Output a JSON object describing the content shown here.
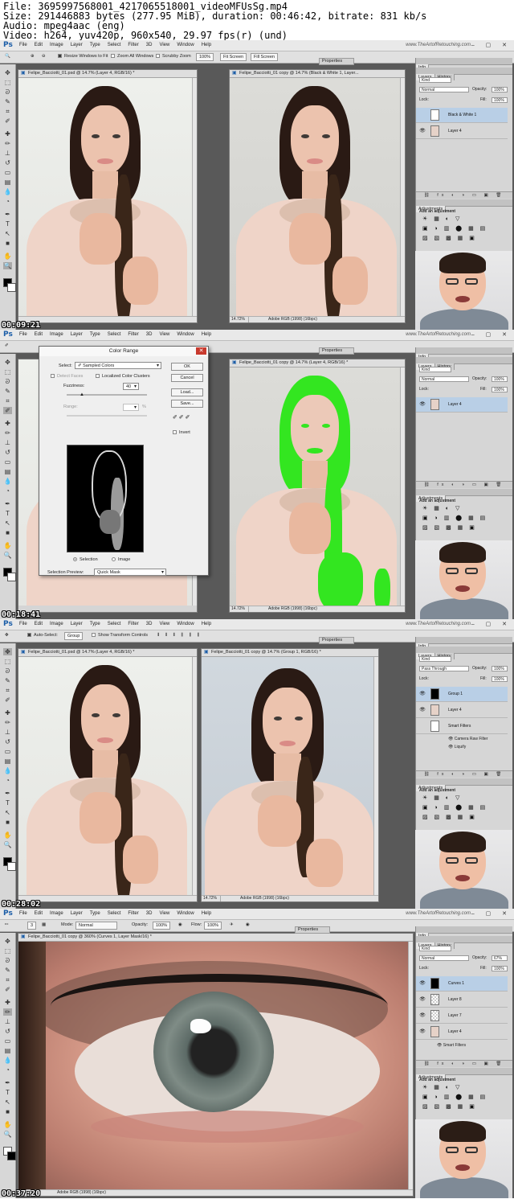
{
  "file_info": {
    "line1": "File: 3695997568001_4217065518001_videoMFUsSg.mp4",
    "line2": "Size: 291446883 bytes (277.95 MiB), duration: 00:46:42, bitrate: 831 kb/s",
    "line3": "Audio: mpeg4aac (eng)",
    "line4": "Video: h264, yuv420p, 960x540, 29.97 fps(r) (und)"
  },
  "app": {
    "logo": "Ps",
    "menus": [
      "File",
      "Edit",
      "Image",
      "Layer",
      "Type",
      "Select",
      "Filter",
      "3D",
      "View",
      "Window",
      "Help"
    ],
    "site": "www.TheArtofRetouching.com",
    "window_controls": "– ▢ ✕"
  },
  "panels": [
    {
      "timecode": "00:09:21",
      "options": {
        "resize": "Resize Windows to Fit",
        "zoom_all": "Zoom All Windows",
        "scrubby": "Scrubby Zoom",
        "zoom_value": "100%",
        "fit_screen": "Fit Screen",
        "fill_screen": "Fill Screen"
      },
      "doc1": {
        "title": "Felipe_Bacciotti_01.psd @ 14.7% (Layer 4, RGB/16) *",
        "zoom": "",
        "profile": ""
      },
      "doc2": {
        "title": "Felipe_Bacciotti_01 copy @ 14.7% (Black & White 1, Layer...",
        "zoom": "14.72%",
        "profile": "Adobe RGB (1998) (16bpc)"
      },
      "tabs": {
        "properties": "Properties",
        "info": "Info"
      },
      "layers_panel": {
        "tabs": [
          "Layers",
          "History"
        ],
        "kind": "Kind",
        "blend": "Normal",
        "opacity_label": "Opacity:",
        "opacity": "100%",
        "lock_label": "Lock:",
        "fill_label": "Fill:",
        "fill": "100%",
        "layers": [
          "Black & White 1",
          "Layer 4"
        ],
        "adjustments_tab": "Adjustments",
        "add_adjustment": "Add an adjustment"
      }
    },
    {
      "timecode": "00:18:41",
      "doc2": {
        "title": "Felipe_Bacciotti_01 copy @ 14.7% (Layer 4, RGB/16) *",
        "zoom": "14.72%",
        "profile": "Adobe RGB (1998) (16bpc)"
      },
      "tabs": {
        "properties": "Properties",
        "info": "Info"
      },
      "color_range": {
        "title": "Color Range",
        "select_label": "Select:",
        "select_value": "Sampled Colors",
        "detect_faces": "Detect Faces",
        "localized": "Localized Color Clusters",
        "fuzziness_label": "Fuzziness:",
        "fuzziness": "40",
        "range_label": "Range:",
        "range_unit": "%",
        "ok": "OK",
        "cancel": "Cancel",
        "load": "Load...",
        "save": "Save...",
        "invert": "Invert",
        "selection": "Selection",
        "image": "Image",
        "preview_label": "Selection Preview:",
        "preview_value": "Quick Mask"
      },
      "layers_panel": {
        "tabs": [
          "Layers",
          "History"
        ],
        "kind": "Kind",
        "blend": "Normal",
        "opacity_label": "Opacity:",
        "opacity": "100%",
        "lock_label": "Lock:",
        "fill_label": "Fill:",
        "fill": "100%",
        "layers": [
          "Layer 4"
        ],
        "adjustments_tab": "Adjustments",
        "add_adjustment": "Add an adjustment"
      }
    },
    {
      "timecode": "00:28:02",
      "options": {
        "auto_select": "Auto-Select:",
        "group": "Group",
        "transform": "Show Transform Controls"
      },
      "doc1": {
        "title": "Felipe_Bacciotti_01.psd @ 14.7% (Layer 4, RGB/16) *",
        "zoom": "",
        "profile": ""
      },
      "doc2": {
        "title": "Felipe_Bacciotti_01 copy @ 14.7% (Group 1, RGB/16) *",
        "zoom": "14.72%",
        "profile": "Adobe RGB (1998) (16bpc)"
      },
      "tabs": {
        "properties": "Properties",
        "info": "Info"
      },
      "layers_panel": {
        "tabs": [
          "Layers",
          "History"
        ],
        "kind": "Kind",
        "blend": "Pass Through",
        "opacity_label": "Opacity:",
        "opacity": "100%",
        "lock_label": "Lock:",
        "fill_label": "Fill:",
        "fill": "100%",
        "layers": [
          "Group 1",
          "Layer 4",
          "Smart Filters",
          "Camera Raw Filter",
          "Liquify"
        ],
        "adjustments_tab": "Adjustments",
        "add_adjustment": "Add an adjustment"
      }
    },
    {
      "timecode": "00:37:20",
      "options": {
        "brush_size": "3",
        "mode_label": "Mode:",
        "mode": "Normal",
        "opacity_label": "Opacity:",
        "opacity": "100%",
        "flow_label": "Flow:",
        "flow": "100%"
      },
      "doc1": {
        "title": "Felipe_Bacciotti_01 copy @ 360% (Curves 1, Layer Mask/16) *",
        "zoom": "",
        "profile": "Adobe RGB (1998) (16bpc)"
      },
      "tabs": {
        "properties": "Properties",
        "info": "Info"
      },
      "layers_panel": {
        "tabs": [
          "Layers",
          "History"
        ],
        "kind": "Kind",
        "blend": "Normal",
        "opacity_label": "Opacity:",
        "opacity": "67%",
        "lock_label": "Lock:",
        "fill_label": "Fill:",
        "fill": "100%",
        "layers": [
          "Curves 1",
          "Layer 8",
          "Layer 7",
          "Layer 4",
          "Smart Filters"
        ],
        "adjustments_tab": "Adjustments",
        "add_adjustment": "Add an adjustment"
      }
    }
  ],
  "icons": {
    "tools": [
      "move",
      "marquee",
      "lasso",
      "quick-select",
      "crop",
      "eyedropper",
      "healing",
      "brush",
      "stamp",
      "history-brush",
      "eraser",
      "gradient",
      "blur",
      "dodge",
      "pen",
      "type",
      "path-select",
      "shape",
      "hand",
      "zoom"
    ],
    "adjustments_row1": "☀ ▦ ◐ ▽",
    "adjustments_row2": "▣ ◑ ▥ ⬤ ▦ ▤",
    "adjustments_row3": "▨ ▧ ▩ ▦ ▣"
  },
  "colors": {
    "accent": "#1c5ea8",
    "selection": "#b9cfe6",
    "quick_mask_green": "#33e620",
    "close_red": "#c8392d"
  }
}
